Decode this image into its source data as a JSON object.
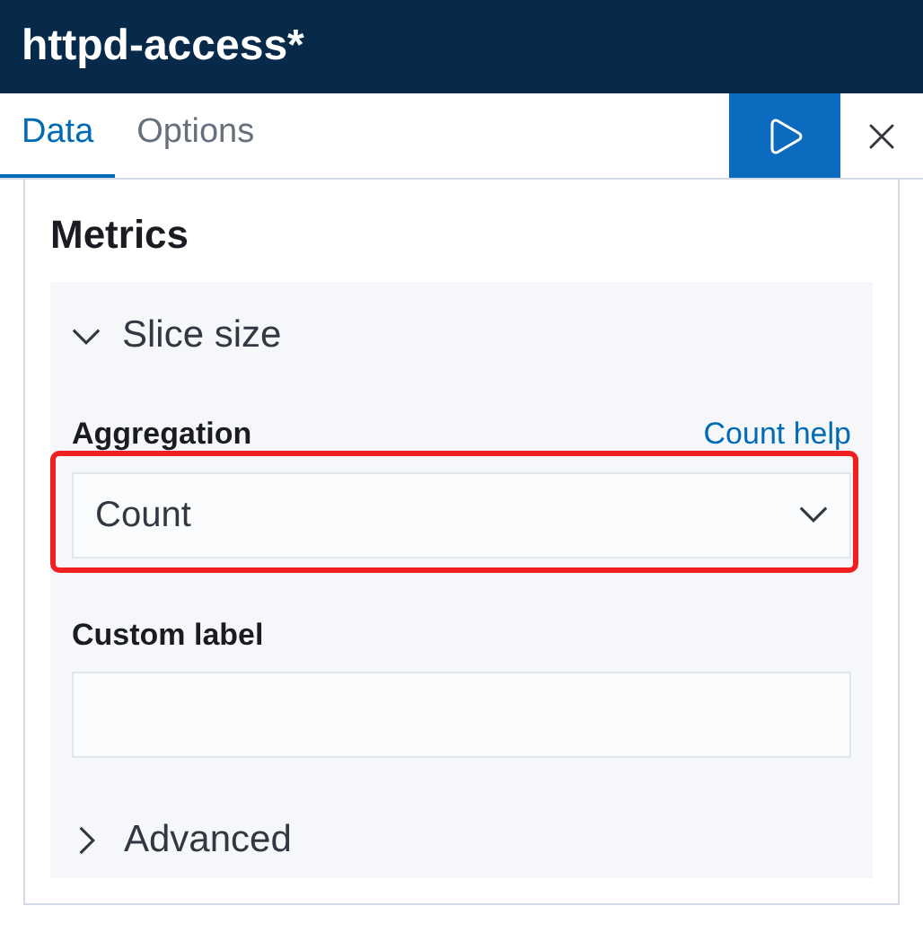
{
  "header": {
    "title": "httpd-access*"
  },
  "tabs": [
    {
      "label": "Data",
      "selected": true
    },
    {
      "label": "Options",
      "selected": false
    }
  ],
  "section": {
    "title": "Metrics",
    "group": {
      "title": "Slice size",
      "expanded": true,
      "aggregation": {
        "label": "Aggregation",
        "help_link": "Count help",
        "value": "Count"
      },
      "custom_label": {
        "label": "Custom label"
      },
      "advanced": {
        "title": "Advanced",
        "expanded": false
      }
    }
  }
}
